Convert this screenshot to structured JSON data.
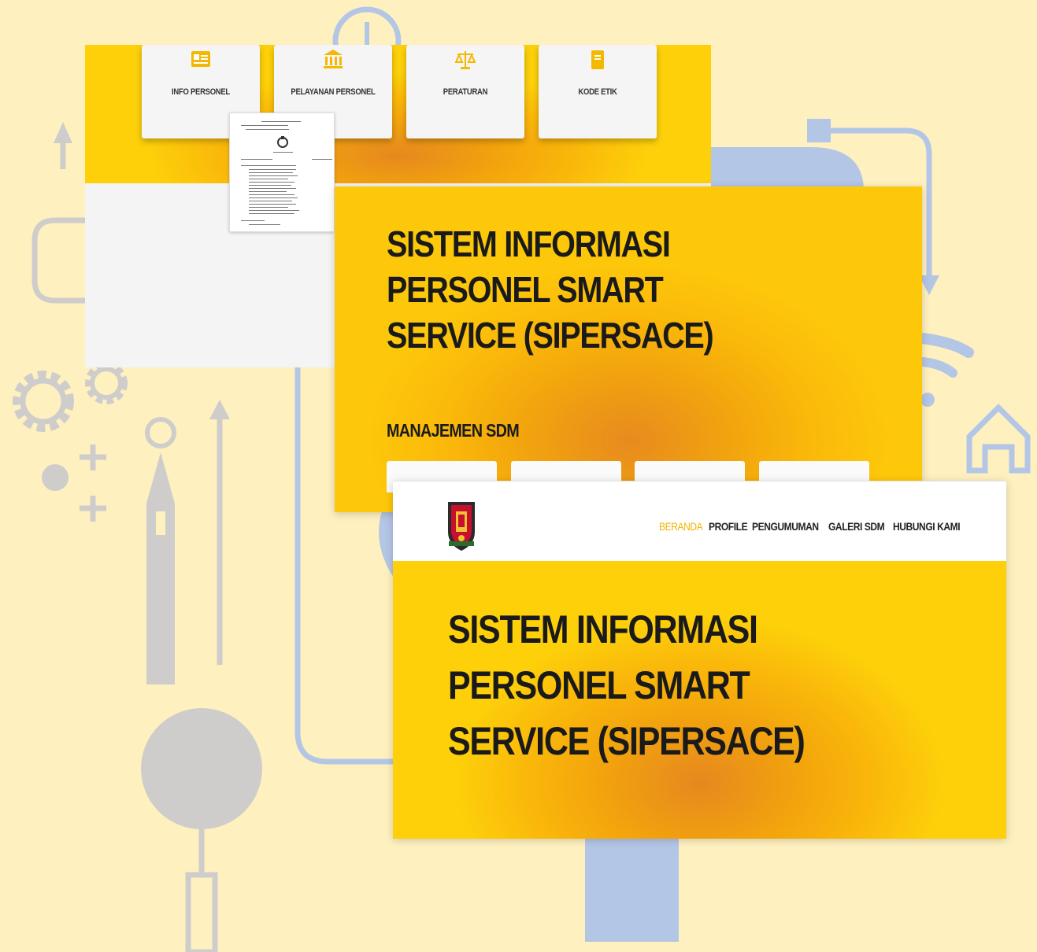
{
  "colors": {
    "background": "#fef0bf",
    "grey_deco": "#cfcdcb",
    "blue_deco": "#b4c6e6",
    "yellow": "#fdc80a",
    "orange": "#e88a1e",
    "nav_active": "#f3b400",
    "text_dark": "#1a1a1a"
  },
  "top_panel": {
    "cards": [
      {
        "label": "INFO PERSONEL",
        "icon": "id-card-icon"
      },
      {
        "label": "PELAYANAN PERSONEL",
        "icon": "bank-building-icon"
      },
      {
        "label": "PERATURAN",
        "icon": "scale-balance-icon"
      },
      {
        "label": "KODE ETIK",
        "icon": "book-icon"
      }
    ]
  },
  "middle_panel": {
    "title_lines": [
      "SISTEM INFORMASI",
      "PERSONEL SMART",
      "SERVICE (SIPERSACE)"
    ],
    "subtitle": "MANAJEMEN SDM"
  },
  "front_panel": {
    "logo": "police-emblem-logo",
    "nav": [
      "BERANDA",
      "PROFILE",
      "PENGUMUMAN",
      "GALERI SDM",
      "HUBUNGI KAMI"
    ],
    "active_nav": "BERANDA",
    "title_lines": [
      "SISTEM INFORMASI",
      "PERSONEL SMART",
      "SERVICE (SIPERSACE)"
    ]
  }
}
